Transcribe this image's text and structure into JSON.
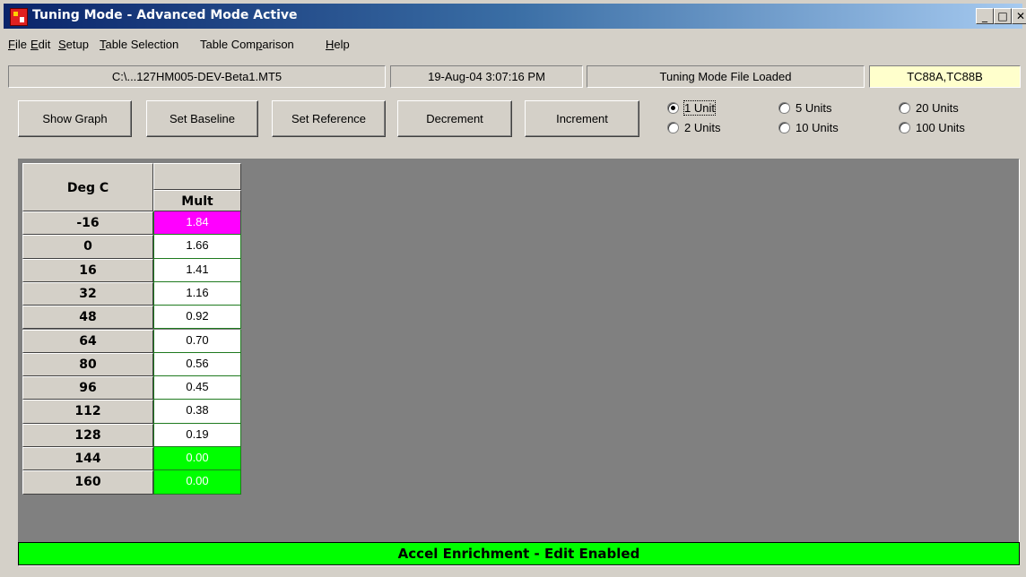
{
  "window": {
    "title": "Tuning Mode - Advanced Mode Active",
    "controls": {
      "minimize": "_",
      "maximize": "□",
      "close": "✕"
    }
  },
  "menu": [
    {
      "pre": "",
      "u": "F",
      "post": "ile"
    },
    {
      "pre": "",
      "u": "E",
      "post": "dit"
    },
    {
      "pre": "",
      "u": "S",
      "post": "etup"
    },
    {
      "pre": "",
      "u": "T",
      "post": "able Selection"
    },
    {
      "pre": "Table Com",
      "u": "p",
      "post": "arison"
    },
    {
      "pre": "",
      "u": "H",
      "post": "elp"
    }
  ],
  "status": {
    "file_path": "C:\\...127HM005-DEV-Beta1.MT5",
    "datetime": "19-Aug-04 3:07:16 PM",
    "mode": "Tuning Mode File Loaded",
    "ecm": "TC88A,TC88B"
  },
  "buttons": {
    "show_graph": "Show Graph",
    "set_baseline": "Set Baseline",
    "set_reference": "Set Reference",
    "decrement": "Decrement",
    "increment": "Increment"
  },
  "units": {
    "selected": "1 Unit",
    "options": [
      "1 Unit",
      "2 Units",
      "5 Units",
      "10 Units",
      "20 Units",
      "100 Units"
    ]
  },
  "table": {
    "row_header_title": "Deg C",
    "col_header_title": "Mult",
    "rows": [
      {
        "label": "-16",
        "value": "1.84",
        "state": "mag"
      },
      {
        "label": "0",
        "value": "1.66",
        "state": ""
      },
      {
        "label": "16",
        "value": "1.41",
        "state": ""
      },
      {
        "label": "32",
        "value": "1.16",
        "state": ""
      },
      {
        "label": "48",
        "value": "0.92",
        "state": ""
      },
      {
        "label": "64",
        "value": "0.70",
        "state": ""
      },
      {
        "label": "80",
        "value": "0.56",
        "state": ""
      },
      {
        "label": "96",
        "value": "0.45",
        "state": ""
      },
      {
        "label": "112",
        "value": "0.38",
        "state": ""
      },
      {
        "label": "128",
        "value": "0.19",
        "state": ""
      },
      {
        "label": "144",
        "value": "0.00",
        "state": "grn"
      },
      {
        "label": "160",
        "value": "0.00",
        "state": "grn"
      }
    ]
  },
  "footer": {
    "status": "Accel Enrichment - Edit Enabled"
  },
  "colors": {
    "highlight_cell": "#ff00ff",
    "locked_cell": "#00ff00",
    "status_bar": "#00ff00",
    "ecm_field": "#ffffcc"
  }
}
